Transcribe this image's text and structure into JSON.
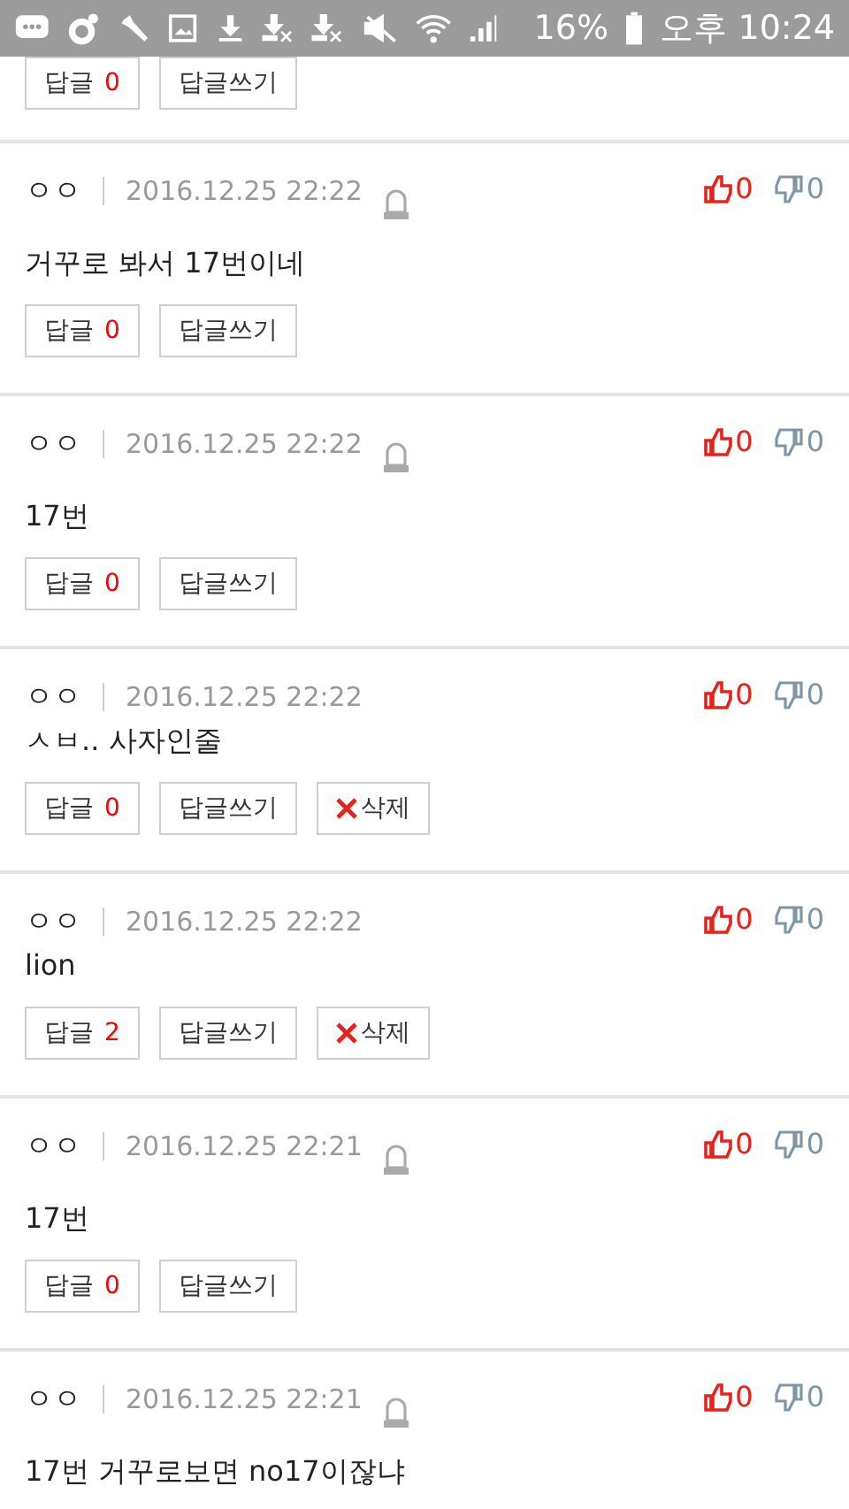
{
  "status_bar": {
    "battery": "16%",
    "time": "오후 10:24"
  },
  "top_actions": {
    "replies_label": "답글",
    "reply_count": "0",
    "write_label": "답글쓰기"
  },
  "comments": [
    {
      "author": "ㅇㅇ",
      "date": "2016.12.25 22:22",
      "locked": true,
      "likes": "0",
      "dislikes": "0",
      "text": "거꾸로 봐서 17번이네",
      "replies_label": "답글",
      "reply_count": "0",
      "write_label": "답글쓰기"
    },
    {
      "author": "ㅇㅇ",
      "date": "2016.12.25 22:22",
      "locked": true,
      "likes": "0",
      "dislikes": "0",
      "text": "17번",
      "replies_label": "답글",
      "reply_count": "0",
      "write_label": "답글쓰기"
    },
    {
      "author": "ㅇㅇ",
      "date": "2016.12.25 22:22",
      "locked": false,
      "likes": "0",
      "dislikes": "0",
      "text": "ㅅㅂ.. 사자인줄",
      "replies_label": "답글",
      "reply_count": "0",
      "write_label": "답글쓰기",
      "delete_label": "삭제"
    },
    {
      "author": "ㅇㅇ",
      "date": "2016.12.25 22:22",
      "locked": false,
      "likes": "0",
      "dislikes": "0",
      "text": "lion",
      "replies_label": "답글",
      "reply_count": "2",
      "write_label": "답글쓰기",
      "delete_label": "삭제"
    },
    {
      "author": "ㅇㅇ",
      "date": "2016.12.25 22:21",
      "locked": true,
      "likes": "0",
      "dislikes": "0",
      "text": "17번",
      "replies_label": "답글",
      "reply_count": "0",
      "write_label": "답글쓰기"
    },
    {
      "author": "ㅇㅇ",
      "date": "2016.12.25 22:21",
      "locked": true,
      "likes": "0",
      "dislikes": "0",
      "text": "17번 거꾸로보면 no17이잖냐"
    }
  ]
}
